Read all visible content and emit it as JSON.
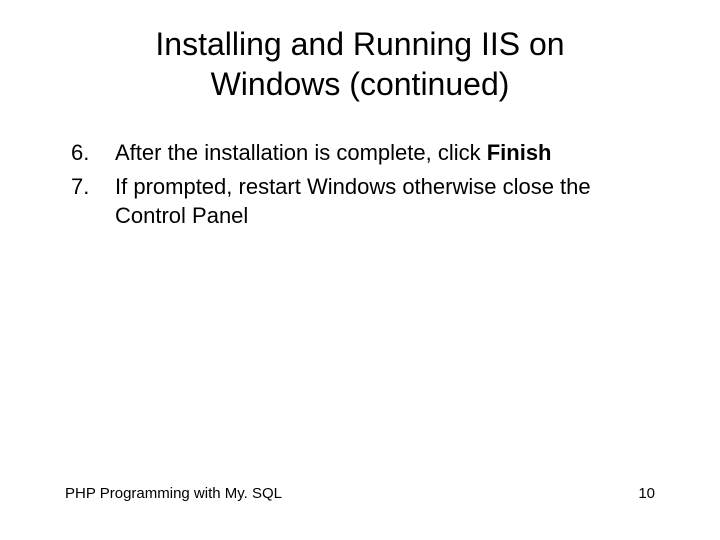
{
  "title_line1": "Installing and Running IIS on",
  "title_line2": "Windows (continued)",
  "items": [
    {
      "pre": "After the installation is complete, click ",
      "bold": "Finish",
      "post": ""
    },
    {
      "pre": "If prompted, restart Windows otherwise close the Control Panel",
      "bold": "",
      "post": ""
    }
  ],
  "footer_left": "PHP Programming with My. SQL",
  "footer_right": "10"
}
